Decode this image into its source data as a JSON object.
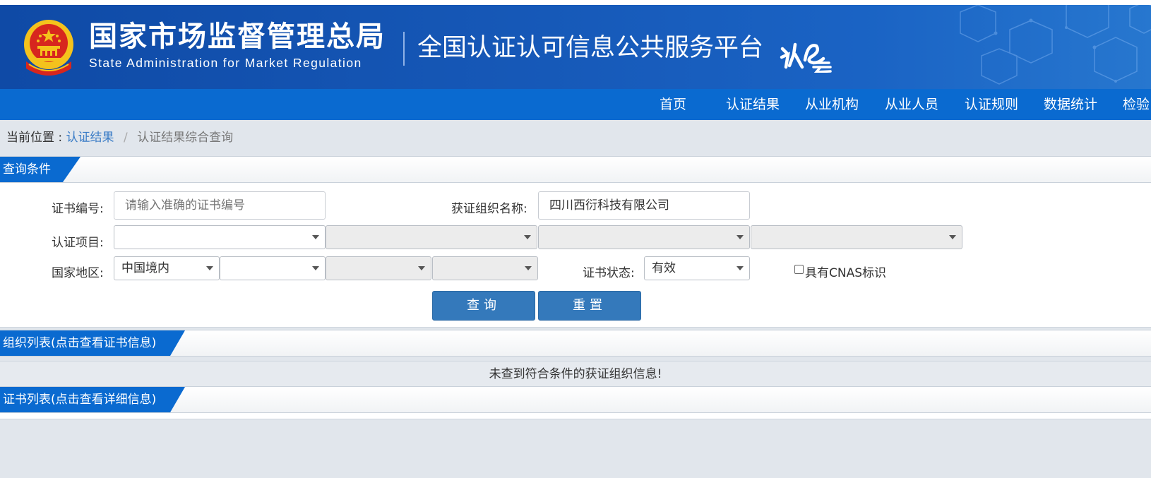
{
  "header": {
    "agency_cn": "国家市场监督管理总局",
    "agency_en": "State Administration  for  Market Regulation",
    "platform": "全国认证认可信息公共服务平台",
    "logo_text": "认e云"
  },
  "nav": {
    "items": [
      "首页",
      "认证结果",
      "从业机构",
      "从业人员",
      "认证规则",
      "数据统计",
      "检验"
    ]
  },
  "breadcrumb": {
    "prefix": "当前位置 :",
    "link": "认证结果",
    "separator": "/",
    "current": "认证结果综合查询"
  },
  "query": {
    "section_title": "查询条件",
    "cert_no_label": "证书编号:",
    "cert_no_placeholder": "请输入准确的证书编号",
    "org_name_label": "获证组织名称:",
    "org_name_value": "四川西衍科技有限公司",
    "project_label": "认证项目:",
    "region_label": "国家地区:",
    "region_value": "中国境内",
    "status_label": "证书状态:",
    "status_value": "有效",
    "cnas_label": "具有CNAS标识",
    "search_button": "查询",
    "reset_button": "重置"
  },
  "org_list": {
    "section_title": "组织列表(点击查看证书信息)",
    "empty_message": "未查到符合条件的获证组织信息!"
  },
  "cert_list": {
    "section_title": "证书列表(点击查看详细信息)"
  },
  "colors": {
    "header_bg": "#1658b7",
    "nav_bg": "#0a6ad0",
    "button_bg": "#3479bb",
    "link": "#3a7cc6"
  }
}
